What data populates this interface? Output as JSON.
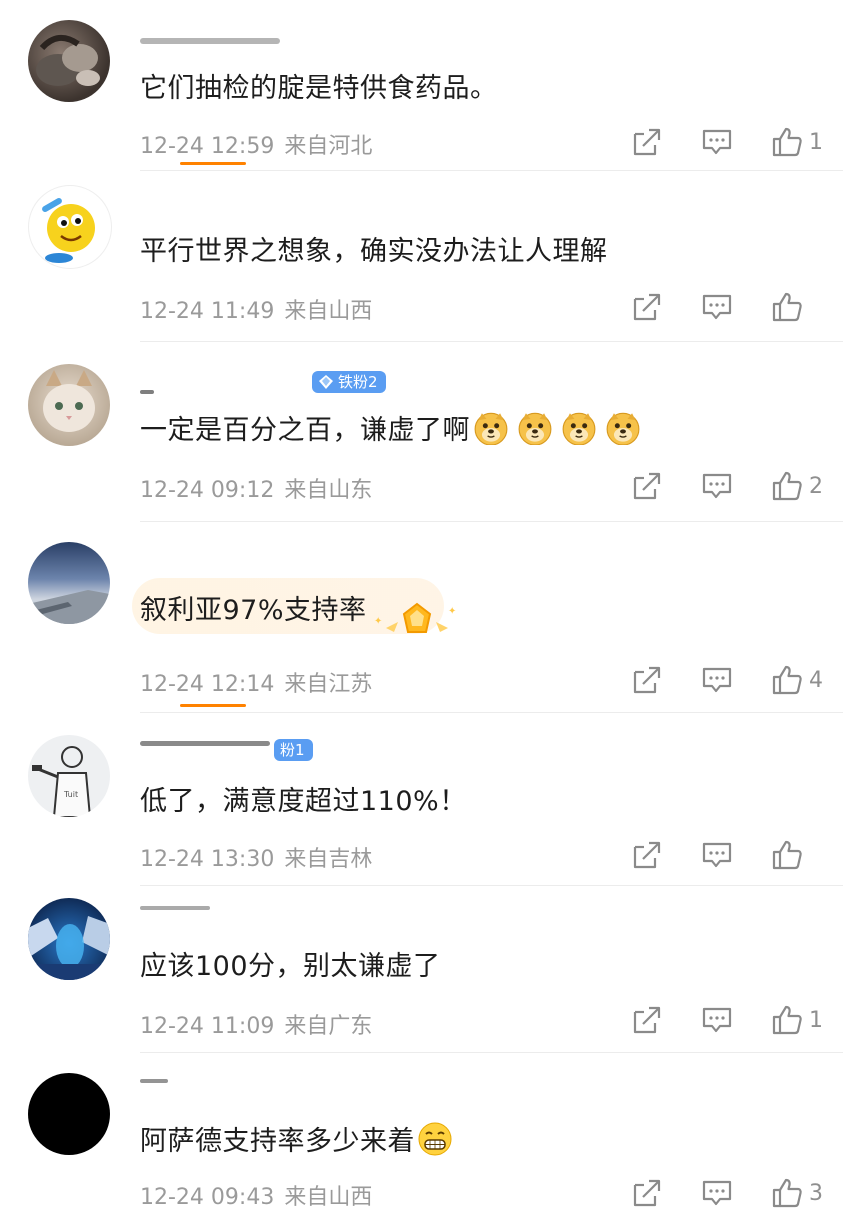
{
  "comments": [
    {
      "text": "它们抽检的腚是特供食药品。",
      "time": "12-24 12:59",
      "location": "来自河北",
      "likes": "1"
    },
    {
      "text": "平行世界之想象，确实没办法让人理解",
      "time": "12-24 11:49",
      "location": "来自山西",
      "likes": ""
    },
    {
      "text": "一定是百分之百，谦虚了啊",
      "badge": "铁粉2",
      "time": "12-24 09:12",
      "location": "来自山东",
      "likes": "2"
    },
    {
      "text": "叙利亚97%支持率",
      "time": "12-24 12:14",
      "location": "来自江苏",
      "likes": "4"
    },
    {
      "text": "低了，满意度超过110%！",
      "badge": "粉1",
      "time": "12-24 13:30",
      "location": "来自吉林",
      "likes": ""
    },
    {
      "text": "应该100分，别太谦虚了",
      "time": "12-24 11:09",
      "location": "来自广东",
      "likes": "1"
    },
    {
      "text": "阿萨德支持率多少来着",
      "time": "12-24 09:43",
      "location": "来自山西",
      "likes": "3"
    }
  ],
  "colors": {
    "accent": "#ff8200",
    "meta_text": "#9a9a9a",
    "badge": "#5a9df2"
  },
  "icons": [
    "share-icon",
    "comment-icon",
    "like-icon",
    "doge-emoji",
    "grin-emoji",
    "gold-medal-icon"
  ]
}
